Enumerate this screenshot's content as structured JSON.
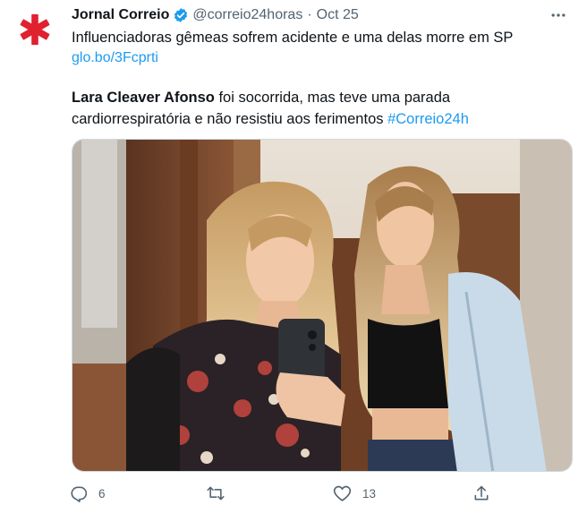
{
  "account": {
    "display_name": "Jornal Correio",
    "handle": "@correio24horas",
    "separator": "·",
    "date": "Oct 25",
    "avatar_icon": "asterisk-logo-icon",
    "verified_icon": "verified-badge-icon"
  },
  "tweet": {
    "line1": "Influenciadoras gêmeas sofrem acidente e uma delas morre em SP",
    "link": "glo.bo/3Fcprti",
    "para2_bold": "Lara Cleaver Afonso",
    "para2_text_a": " foi socorrida, mas teve uma parada",
    "para2_text_b": "cardiorrespiratória e não resistiu aos ferimentos ",
    "hashtag": "#Correio24h"
  },
  "actions": {
    "reply_count": "6",
    "retweet_count": "",
    "like_count": "13",
    "reply_icon": "reply-icon",
    "retweet_icon": "retweet-icon",
    "like_icon": "heart-icon",
    "share_icon": "share-icon",
    "more_icon": "more-options-icon"
  },
  "colors": {
    "brand_red": "#e0212f",
    "link_blue": "#1d9bf0",
    "muted": "#536471",
    "text": "#0f1419"
  }
}
